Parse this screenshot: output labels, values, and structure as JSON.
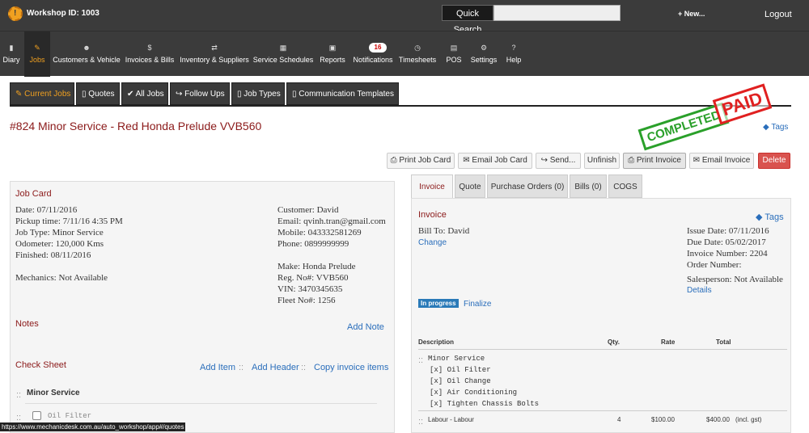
{
  "topbar": {
    "workshop_id": "Workshop ID: 1003",
    "quick_search_label": "Quick Search",
    "quick_search_value": "",
    "new_label": "+ New...",
    "logout_label": "Logout"
  },
  "nav": {
    "items": [
      {
        "label": "Diary",
        "icon": "diary-icon"
      },
      {
        "label": "Jobs",
        "icon": "wrench-icon"
      },
      {
        "label": "Customers & Vehicle",
        "icon": "users-icon"
      },
      {
        "label": "Invoices & Bills",
        "icon": "dollar-icon"
      },
      {
        "label": "Inventory & Suppliers",
        "icon": "exchange-icon"
      },
      {
        "label": "Service Schedules",
        "icon": "calendar-icon"
      },
      {
        "label": "Reports",
        "icon": "image-icon"
      },
      {
        "label": "Notifications",
        "icon": "bell-icon",
        "badge": "16"
      },
      {
        "label": "Timesheets",
        "icon": "clock-icon"
      },
      {
        "label": "POS",
        "icon": "pos-icon"
      },
      {
        "label": "Settings",
        "icon": "gears-icon"
      },
      {
        "label": "Help",
        "icon": "question-icon"
      }
    ]
  },
  "subtabs": [
    "Current Jobs",
    "Quotes",
    "All Jobs",
    "Follow Ups",
    "Job Types",
    "Communication Templates"
  ],
  "job": {
    "title": "#824 Minor Service - Red Honda Prelude VVB560",
    "stamp_completed": "COMPLETED",
    "stamp_paid": "PAID",
    "tags": "Tags"
  },
  "actions": [
    "Print Job Card",
    "Email Job Card",
    "Send...",
    "Unfinish",
    "Print Invoice",
    "Email Invoice",
    "Delete"
  ],
  "jobcard": {
    "title": "Job Card",
    "date": "Date: 07/11/2016",
    "pickup": "Pickup time: 7/11/16 4:35 PM",
    "jobtype": "Job Type: Minor Service",
    "odometer": "Odometer: 120,000 Kms",
    "finished": "Finished: 08/11/2016",
    "mechanics": "Mechanics: Not Available",
    "customer": "Customer: David",
    "email": "Email: qvinh.tran@gmail.com",
    "mobile": "Mobile: 043332581269",
    "phone": "Phone: 0899999999",
    "make": "Make: Honda Prelude",
    "reg": "Reg. No#: VVB560",
    "vin": "VIN: 3470345635",
    "fleet": "Fleet No#: 1256",
    "notes": "Notes",
    "add_note": "Add Note",
    "check_sheet": "Check Sheet",
    "add_item": "Add Item",
    "add_header": "Add Header",
    "copy_items": "Copy invoice items",
    "cs_header": "Minor Service",
    "cs_item": "Oil Filter"
  },
  "invoice": {
    "tabs": [
      "Invoice",
      "Quote",
      "Purchase Orders (0)",
      "Bills (0)",
      "COGS"
    ],
    "title": "Invoice",
    "tags": "Tags",
    "bill_to": "Bill To: David",
    "change": "Change",
    "issue_date": "Issue Date: 07/11/2016",
    "due_date": "Due Date: 05/02/2017",
    "invoice_number": "Invoice Number: 2204",
    "order_number": "Order Number:",
    "salesperson": "Salesperson: Not Available",
    "details": "Details",
    "status": "In progress",
    "finalize": "Finalize",
    "col_desc": "Description",
    "col_qty": "Qty.",
    "col_rate": "Rate",
    "col_total": "Total",
    "group": "Minor Service",
    "checks": [
      "[x] Oil Filter",
      "[x] Oil Change",
      "[x] Air Conditioning",
      "[x] Tighten Chassis Bolts"
    ],
    "line": {
      "desc": "Labour - Labour",
      "qty": "4",
      "rate": "$100.00",
      "total": "$400.00",
      "note": "(incl. gst)"
    }
  },
  "statusbar": "https://www.mechanicdesk.com.au/auto_workshop/app#/quotes"
}
